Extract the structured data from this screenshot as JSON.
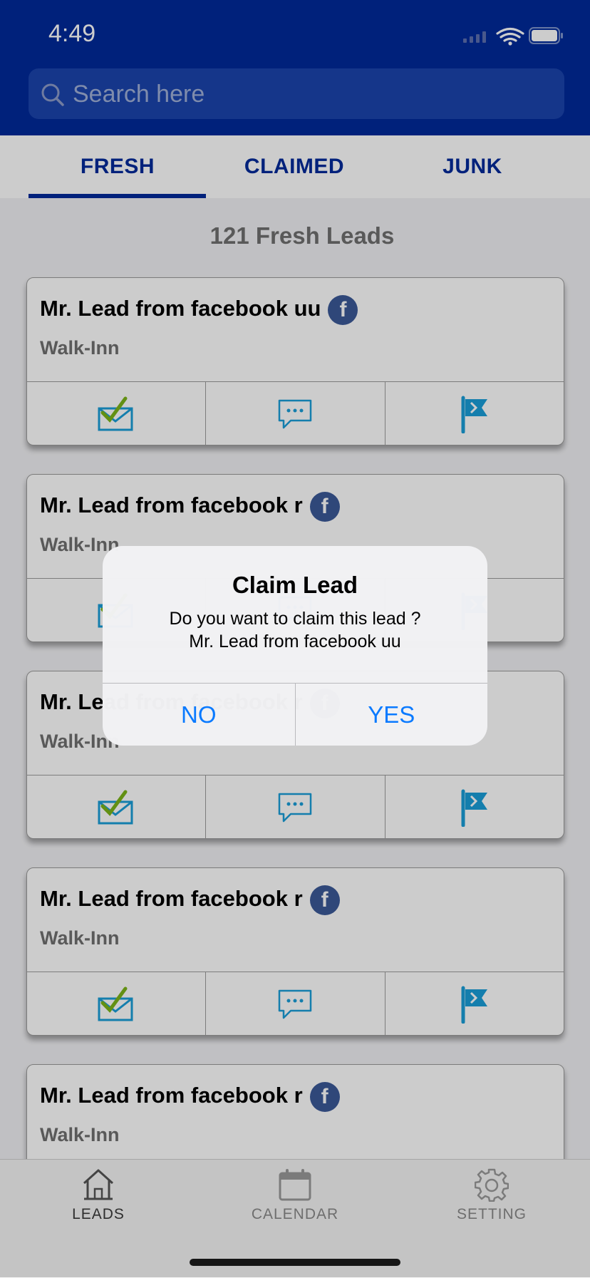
{
  "status_bar": {
    "time": "4:49"
  },
  "search": {
    "placeholder": "Search here"
  },
  "tabs": [
    {
      "label": "FRESH",
      "active": true
    },
    {
      "label": "CLAIMED",
      "active": false
    },
    {
      "label": "JUNK",
      "active": false
    }
  ],
  "leads_count": "121 Fresh Leads",
  "leads": [
    {
      "name": "Mr. Lead from facebook uu",
      "source": "Walk-Inn",
      "channel_icon": "facebook-icon"
    },
    {
      "name": "Mr. Lead from facebook r",
      "source": "Walk-Inn",
      "channel_icon": "facebook-icon"
    },
    {
      "name": "Mr. Lead from facebook r",
      "source": "Walk-Inn",
      "channel_icon": "facebook-icon"
    },
    {
      "name": "Mr. Lead from facebook r",
      "source": "Walk-Inn",
      "channel_icon": "facebook-icon"
    },
    {
      "name": "Mr. Lead from facebook r",
      "source": "Walk-Inn",
      "channel_icon": "facebook-icon"
    }
  ],
  "card_actions": [
    "mail-check-icon",
    "chat-icon",
    "flag-icon"
  ],
  "bottom_nav": [
    {
      "label": "LEADS",
      "icon": "home-icon",
      "active": true
    },
    {
      "label": "CALENDAR",
      "icon": "calendar-icon",
      "active": false
    },
    {
      "label": "SETTING",
      "icon": "gear-icon",
      "active": false
    }
  ],
  "dialog": {
    "title": "Claim Lead",
    "message_line1": "Do you want to claim this lead ?",
    "message_line2": "Mr. Lead from facebook uu",
    "no_label": "NO",
    "yes_label": "YES"
  },
  "colors": {
    "header_bg": "#002a9a",
    "accent_blue": "#0a7aff",
    "icon_blue": "#1a9ed9",
    "check_green": "#7cb518"
  }
}
